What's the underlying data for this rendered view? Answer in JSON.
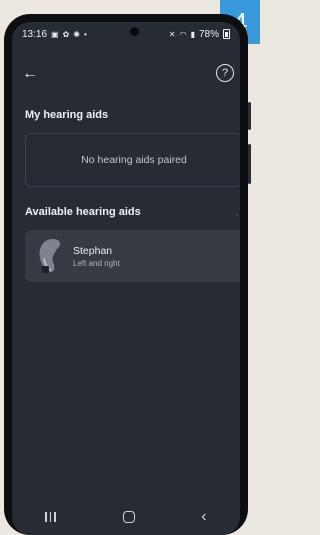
{
  "step_badge": "4",
  "status_bar": {
    "time": "13:16",
    "battery": "78%"
  },
  "header": {
    "back_glyph": "←",
    "help_glyph": "?"
  },
  "my_hearing_aids": {
    "title": "My hearing aids",
    "empty_text": "No hearing aids paired"
  },
  "available_hearing_aids": {
    "title": "Available hearing aids",
    "devices": [
      {
        "name": "Stephan",
        "subtitle": "Left and right"
      }
    ]
  },
  "nav_bar": {
    "back_glyph": "‹"
  }
}
